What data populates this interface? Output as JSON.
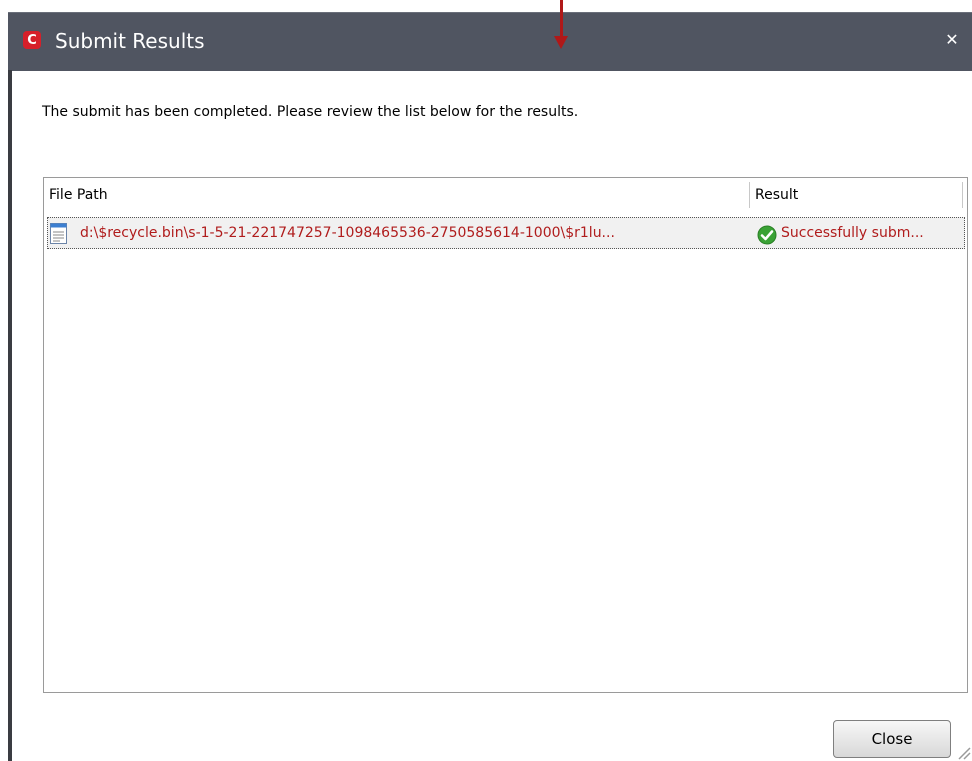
{
  "window": {
    "title": "Submit Results",
    "app_icon_letter": "C"
  },
  "message": "The submit has been completed. Please review the list below for the results.",
  "grid": {
    "columns": [
      "File Path",
      "Result"
    ],
    "rows": [
      {
        "file_path": "d:\\$recycle.bin\\s-1-5-21-221747257-1098465536-2750585614-1000\\$r1lu...",
        "result": "Successfully subm...",
        "status_icon": "check-icon"
      }
    ]
  },
  "buttons": {
    "close": "Close"
  },
  "colors": {
    "titlebar": "#505561",
    "brand_red": "#d6202a",
    "row_text": "#b01c1c",
    "success_green": "#3aa235"
  }
}
